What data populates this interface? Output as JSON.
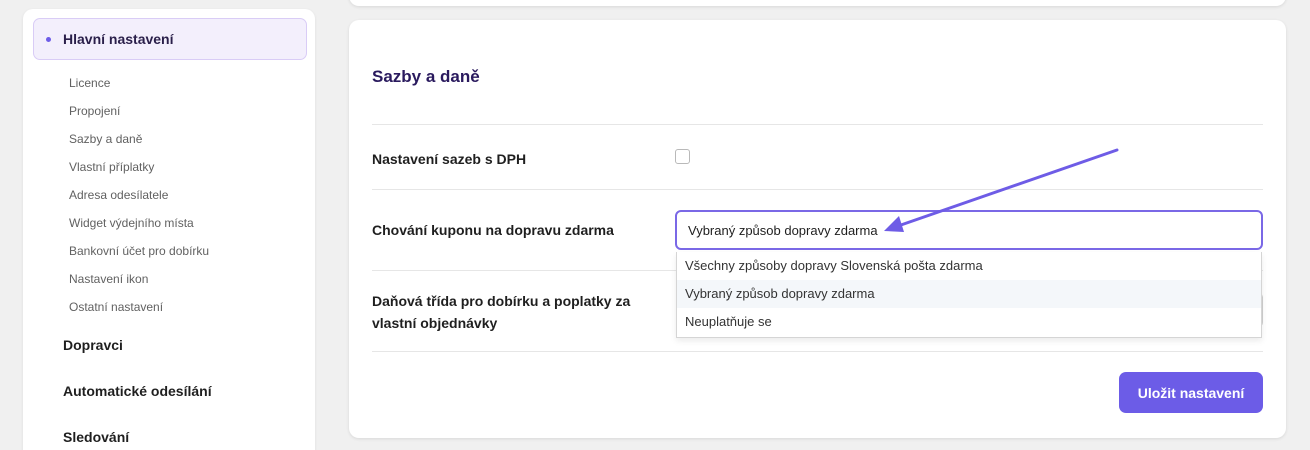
{
  "sidebar": {
    "main_item": "Hlavní nastavení",
    "sub_items": [
      {
        "label": "Licence"
      },
      {
        "label": "Propojení"
      },
      {
        "label": "Sazby a daně"
      },
      {
        "label": "Vlastní příplatky"
      },
      {
        "label": "Adresa odesílatele"
      },
      {
        "label": "Widget výdejního místa"
      },
      {
        "label": "Bankovní účet pro dobírku"
      },
      {
        "label": "Nastavení ikon"
      },
      {
        "label": "Ostatní nastavení"
      }
    ],
    "sections": [
      {
        "label": "Dopravci"
      },
      {
        "label": "Automatické odesílání"
      },
      {
        "label": "Sledování"
      }
    ]
  },
  "card": {
    "title": "Sazby a daně",
    "vat_label": "Nastavení sazeb s DPH",
    "vat_checked": false,
    "coupon_label": "Chování kuponu na dopravu zdarma",
    "coupon_selected": "Vybraný způsob dopravy zdarma",
    "coupon_options": [
      {
        "label": "Všechny způsoby dopravy Slovenská pošta zdarma"
      },
      {
        "label": "Vybraný způsob dopravy zdarma",
        "highlighted": true
      },
      {
        "label": "Neuplatňuje se"
      }
    ],
    "tax_label_line1": "Daňová třída pro dobírku a poplatky za",
    "tax_label_line2": "vlastní objednávky",
    "save_label": "Uložit nastavení"
  },
  "colors": {
    "accent": "#6c5ce7",
    "annotation_arrow": "#6e5ce6",
    "title": "#2a1a5e"
  }
}
